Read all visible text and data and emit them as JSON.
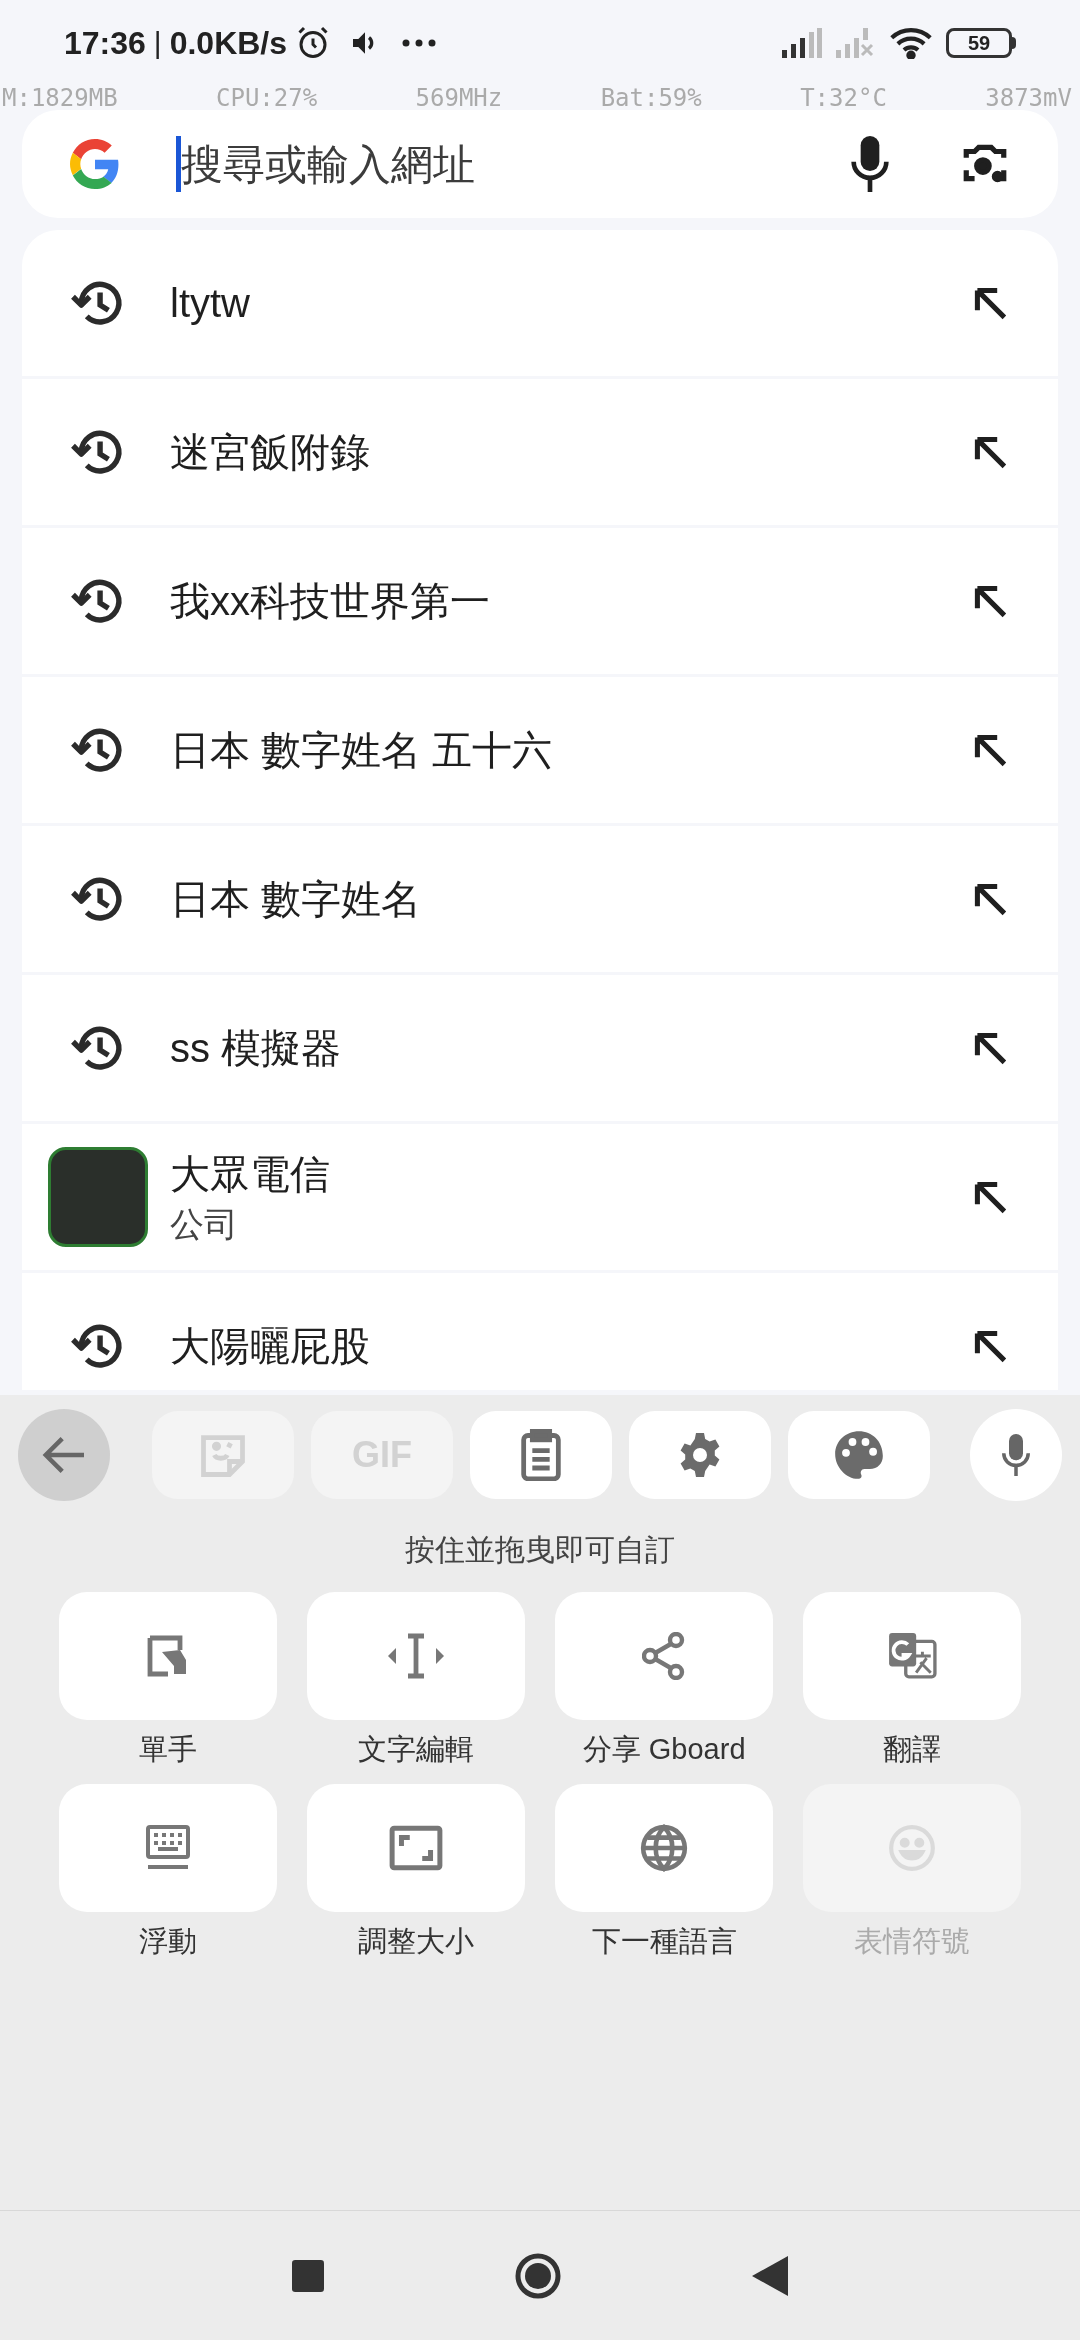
{
  "status_bar": {
    "time": "17:36",
    "separator": "|",
    "network_speed": "0.0KB/s",
    "battery": "59"
  },
  "overlay_stats": [
    "M:1829MB",
    "CPU:27%",
    "569MHz",
    "Bat:59%",
    "T:32°C",
    "3873mV"
  ],
  "search": {
    "placeholder": "搜尋或輸入網址"
  },
  "suggestions": [
    {
      "kind": "history",
      "text": "ltytw"
    },
    {
      "kind": "history",
      "text": "迷宮飯附錄"
    },
    {
      "kind": "history",
      "text": "我xx科技世界第一"
    },
    {
      "kind": "history",
      "text": "日本 數字姓名 五十六"
    },
    {
      "kind": "history",
      "text": "日本 數字姓名"
    },
    {
      "kind": "history",
      "text": "ss 模擬器"
    },
    {
      "kind": "entity",
      "text": "大眾電信",
      "subtitle": "公司"
    },
    {
      "kind": "history",
      "text": "大陽曬屁股"
    }
  ],
  "keyboard": {
    "toolbar": [
      {
        "kind": "sticker",
        "disabled": true
      },
      {
        "kind": "gif",
        "label": "GIF",
        "disabled": true
      },
      {
        "kind": "clipboard",
        "disabled": false
      },
      {
        "kind": "settings",
        "disabled": false
      },
      {
        "kind": "theme",
        "disabled": false
      }
    ],
    "hint": "按住並拖曳即可自訂",
    "tiles": [
      {
        "kind": "one_hand",
        "label": "單手",
        "disabled": false
      },
      {
        "kind": "text_edit",
        "label": "文字編輯",
        "disabled": false
      },
      {
        "kind": "share",
        "label": "分享 Gboard",
        "disabled": false
      },
      {
        "kind": "translate",
        "label": "翻譯",
        "disabled": false
      },
      {
        "kind": "floating",
        "label": "浮動",
        "disabled": false
      },
      {
        "kind": "resize",
        "label": "調整大小",
        "disabled": false
      },
      {
        "kind": "language",
        "label": "下一種語言",
        "disabled": false
      },
      {
        "kind": "emoji",
        "label": "表情符號",
        "disabled": true
      }
    ]
  }
}
